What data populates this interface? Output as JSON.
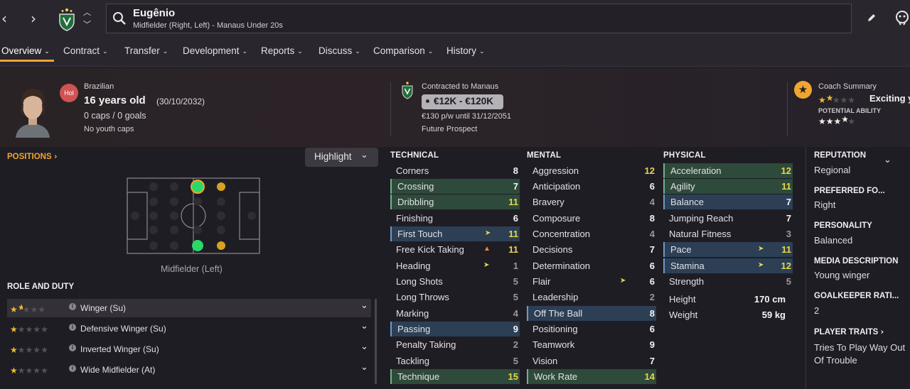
{
  "topbar": {
    "player_name": "Eugênio",
    "player_subtitle": "Midfielder (Right, Left) - Manaus Under 20s"
  },
  "menu": [
    {
      "label": "Overview"
    },
    {
      "label": "Contract"
    },
    {
      "label": "Transfer"
    },
    {
      "label": "Development"
    },
    {
      "label": "Reports"
    },
    {
      "label": "Discuss"
    },
    {
      "label": "Comparison"
    },
    {
      "label": "History"
    }
  ],
  "profile": {
    "nationality": "Brazilian",
    "nation_badge": "Hol",
    "age": "16 years old",
    "dob": "(30/10/2032)",
    "caps": "0 caps / 0 goals",
    "youth_caps": "No youth caps"
  },
  "contract": {
    "label": "Contracted to Manaus",
    "value_range": "€12K - €120K",
    "wage": "€130 p/w until 31/12/2051",
    "status": "Future Prospect"
  },
  "coach": {
    "label": "Coach Summary",
    "summary": "Exciting y",
    "potential_label": "POTENTIAL ABILITY",
    "current_stars": 1.5,
    "potential_stars": 3.5
  },
  "positions": {
    "title": "POSITIONS",
    "highlight_label": "Highlight",
    "caption": "Midfielder (Left)"
  },
  "role_duty": {
    "title": "ROLE AND DUTY",
    "roles": [
      {
        "label": "Winger (Su)",
        "stars": 1.5
      },
      {
        "label": "Defensive Winger (Su)",
        "stars": 1
      },
      {
        "label": "Inverted Winger (Su)",
        "stars": 1
      },
      {
        "label": "Wide Midfielder (At)",
        "stars": 1
      }
    ]
  },
  "technical": {
    "title": "TECHNICAL",
    "attrs": [
      {
        "name": "Corners",
        "value": "8"
      },
      {
        "name": "Crossing",
        "value": "7"
      },
      {
        "name": "Dribbling",
        "value": "11"
      },
      {
        "name": "Finishing",
        "value": "6"
      },
      {
        "name": "First Touch",
        "value": "11"
      },
      {
        "name": "Free Kick Taking",
        "value": "11"
      },
      {
        "name": "Heading",
        "value": "1"
      },
      {
        "name": "Long Shots",
        "value": "5"
      },
      {
        "name": "Long Throws",
        "value": "5"
      },
      {
        "name": "Marking",
        "value": "4"
      },
      {
        "name": "Passing",
        "value": "9"
      },
      {
        "name": "Penalty Taking",
        "value": "2"
      },
      {
        "name": "Tackling",
        "value": "5"
      },
      {
        "name": "Technique",
        "value": "15"
      }
    ]
  },
  "mental": {
    "title": "MENTAL",
    "attrs": [
      {
        "name": "Aggression",
        "value": "12"
      },
      {
        "name": "Anticipation",
        "value": "6"
      },
      {
        "name": "Bravery",
        "value": "4"
      },
      {
        "name": "Composure",
        "value": "8"
      },
      {
        "name": "Concentration",
        "value": "4"
      },
      {
        "name": "Decisions",
        "value": "7"
      },
      {
        "name": "Determination",
        "value": "6"
      },
      {
        "name": "Flair",
        "value": "6"
      },
      {
        "name": "Leadership",
        "value": "2"
      },
      {
        "name": "Off The Ball",
        "value": "8"
      },
      {
        "name": "Positioning",
        "value": "6"
      },
      {
        "name": "Teamwork",
        "value": "9"
      },
      {
        "name": "Vision",
        "value": "7"
      },
      {
        "name": "Work Rate",
        "value": "14"
      }
    ]
  },
  "physical": {
    "title": "PHYSICAL",
    "attrs": [
      {
        "name": "Acceleration",
        "value": "12"
      },
      {
        "name": "Agility",
        "value": "11"
      },
      {
        "name": "Balance",
        "value": "7"
      },
      {
        "name": "Jumping Reach",
        "value": "7"
      },
      {
        "name": "Natural Fitness",
        "value": "3"
      },
      {
        "name": "Pace",
        "value": "11"
      },
      {
        "name": "Stamina",
        "value": "12"
      },
      {
        "name": "Strength",
        "value": "5"
      }
    ],
    "height_label": "Height",
    "height_value": "170 cm",
    "weight_label": "Weight",
    "weight_value": "59 kg"
  },
  "right_panel": {
    "reputation_title": "REPUTATION",
    "reputation_value": "Regional",
    "foot_title": "PREFERRED FO...",
    "foot_value": "Right",
    "personality_title": "PERSONALITY",
    "personality_value": "Balanced",
    "media_title": "MEDIA DESCRIPTION",
    "media_value": "Young winger",
    "gk_title": "GOALKEEPER RATI...",
    "gk_value": "2",
    "traits_title": "PLAYER TRAITS",
    "traits_value_1": "Tries To Play Way Out",
    "traits_value_2": "Of Trouble"
  },
  "colors": {
    "accent": "#f0a531",
    "green_highlight": "#2e4a3a",
    "blue_highlight": "#2c3f55",
    "value_yellow": "#e6d84a"
  }
}
